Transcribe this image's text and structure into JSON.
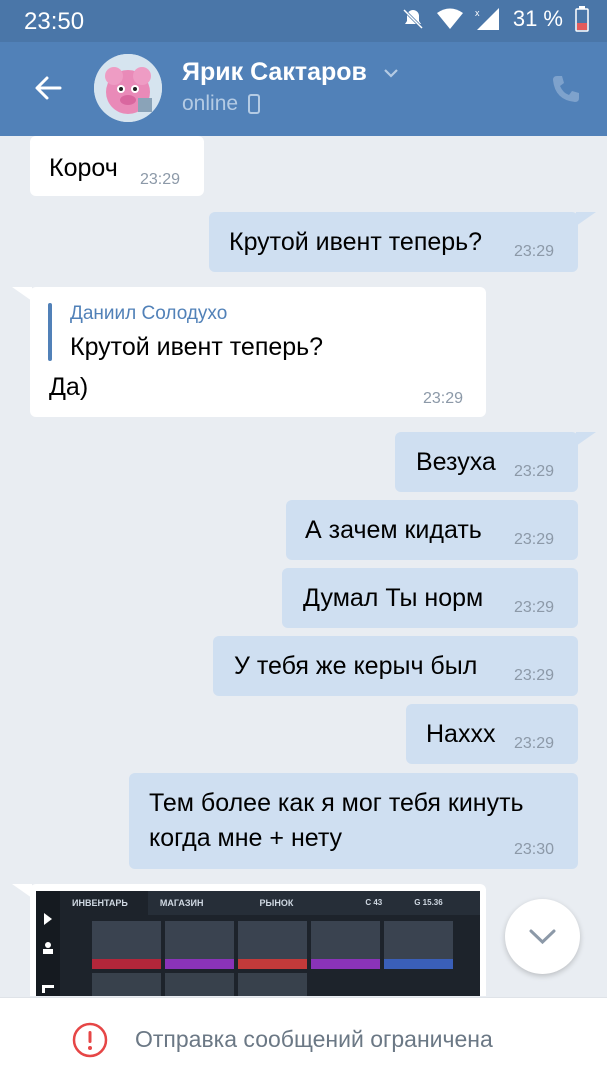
{
  "status_bar": {
    "time": "23:50",
    "battery": "31 %"
  },
  "header": {
    "contact_name": "Ярик Сактаров",
    "status": "online"
  },
  "messages": [
    {
      "text": "Короч",
      "time": "23:29"
    },
    {
      "text": "Крутой ивент теперь?",
      "time": "23:29"
    },
    {
      "reply_author": "Даниил Солодухо",
      "reply_text": "Крутой ивент теперь?",
      "text": "Да)",
      "time": "23:29"
    },
    {
      "text": "Везуха",
      "time": "23:29"
    },
    {
      "text": "А зачем кидать",
      "time": "23:29"
    },
    {
      "text": "Думал Ты норм",
      "time": "23:29"
    },
    {
      "text": "У тебя же керыч был",
      "time": "23:29"
    },
    {
      "text": "Наххх",
      "time": "23:29"
    },
    {
      "text_line1": "Тем более как я мог тебя кинуть",
      "text_line2": "когда мне + нету",
      "time": "23:30"
    }
  ],
  "attachment": {
    "tabs": [
      "ИНВЕНТАРЬ",
      "МАГАЗИН",
      "РЫНОК"
    ],
    "balance_c": "C 43",
    "balance_g": "G 15.36"
  },
  "footer": {
    "restriction_text": "Отправка сообщений ограничена"
  },
  "colors": {
    "header": "#5181b8",
    "status_bar": "#4a76a8",
    "outgoing_bubble": "#cfdff1",
    "incoming_bubble": "#ffffff",
    "background": "#e9edf2"
  }
}
